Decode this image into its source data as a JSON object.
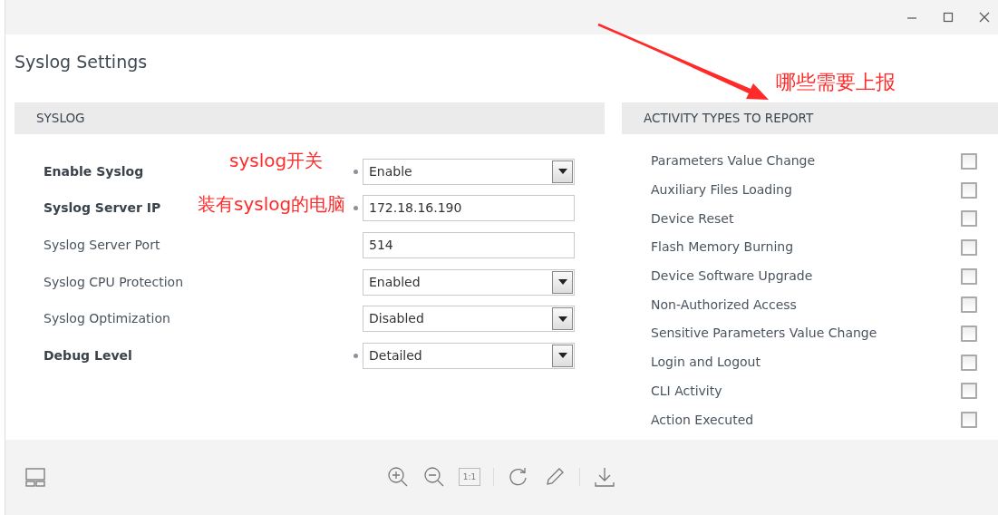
{
  "page": {
    "title": "Syslog Settings"
  },
  "syslog": {
    "heading": "SYSLOG",
    "fields": [
      {
        "label": "Enable Syslog",
        "modified": true,
        "kind": "select",
        "value": "Enable",
        "note": "syslog开关"
      },
      {
        "label": "Syslog Server IP",
        "modified": true,
        "kind": "text",
        "value": "172.18.16.190",
        "note": "装有syslog的电脑"
      },
      {
        "label": "Syslog Server Port",
        "modified": false,
        "kind": "text",
        "value": "514"
      },
      {
        "label": "Syslog CPU Protection",
        "modified": false,
        "kind": "select",
        "value": "Enabled"
      },
      {
        "label": "Syslog Optimization",
        "modified": false,
        "kind": "select",
        "value": "Disabled"
      },
      {
        "label": "Debug Level",
        "modified": true,
        "kind": "select",
        "value": "Detailed"
      }
    ]
  },
  "activity": {
    "heading": "ACTIVITY TYPES TO REPORT",
    "note": "哪些需要上报",
    "items": [
      {
        "label": "Parameters Value Change",
        "checked": false
      },
      {
        "label": "Auxiliary Files Loading",
        "checked": false
      },
      {
        "label": "Device Reset",
        "checked": false
      },
      {
        "label": "Flash Memory Burning",
        "checked": false
      },
      {
        "label": "Device Software Upgrade",
        "checked": false
      },
      {
        "label": "Non-Authorized Access",
        "checked": false
      },
      {
        "label": "Sensitive Parameters Value Change",
        "checked": false
      },
      {
        "label": "Login and Logout",
        "checked": false
      },
      {
        "label": "CLI Activity",
        "checked": false
      },
      {
        "label": "Action Executed",
        "checked": false
      }
    ]
  },
  "toolbar": {
    "left": [
      {
        "kind": "layout"
      }
    ],
    "center": [
      {
        "kind": "zoom-in"
      },
      {
        "kind": "zoom-out"
      },
      {
        "kind": "actual-size",
        "label": "1:1"
      },
      {
        "kind": "separator"
      },
      {
        "kind": "rotate"
      },
      {
        "kind": "edit"
      },
      {
        "kind": "separator"
      },
      {
        "kind": "download"
      }
    ]
  }
}
